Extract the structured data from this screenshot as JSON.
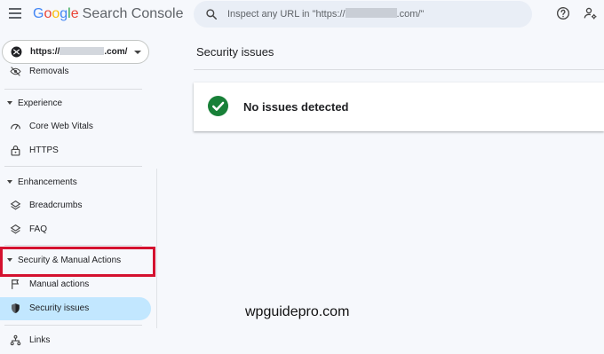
{
  "header": {
    "logo_google": [
      "G",
      "o",
      "o",
      "g",
      "l",
      "e"
    ],
    "product_name": "Search Console",
    "search_placeholder_prefix": "Inspect any URL in \"https://",
    "search_placeholder_suffix": ".com/\""
  },
  "property": {
    "prefix": "https://",
    "suffix": ".com/"
  },
  "sidebar": {
    "partial_item": "Removals",
    "sections": {
      "experience": "Experience",
      "enhancements": "Enhancements",
      "security": "Security & Manual Actions"
    },
    "items": {
      "core_web_vitals": "Core Web Vitals",
      "https": "HTTPS",
      "breadcrumbs": "Breadcrumbs",
      "faq": "FAQ",
      "manual_actions": "Manual actions",
      "security_issues": "Security issues",
      "links": "Links"
    }
  },
  "main": {
    "title": "Security issues",
    "status_message": "No issues detected"
  },
  "watermark": "wpguidepro.com",
  "colors": {
    "accent_selected": "#c2e7ff",
    "success_green": "#188038",
    "highlight_red": "#d4112f"
  }
}
